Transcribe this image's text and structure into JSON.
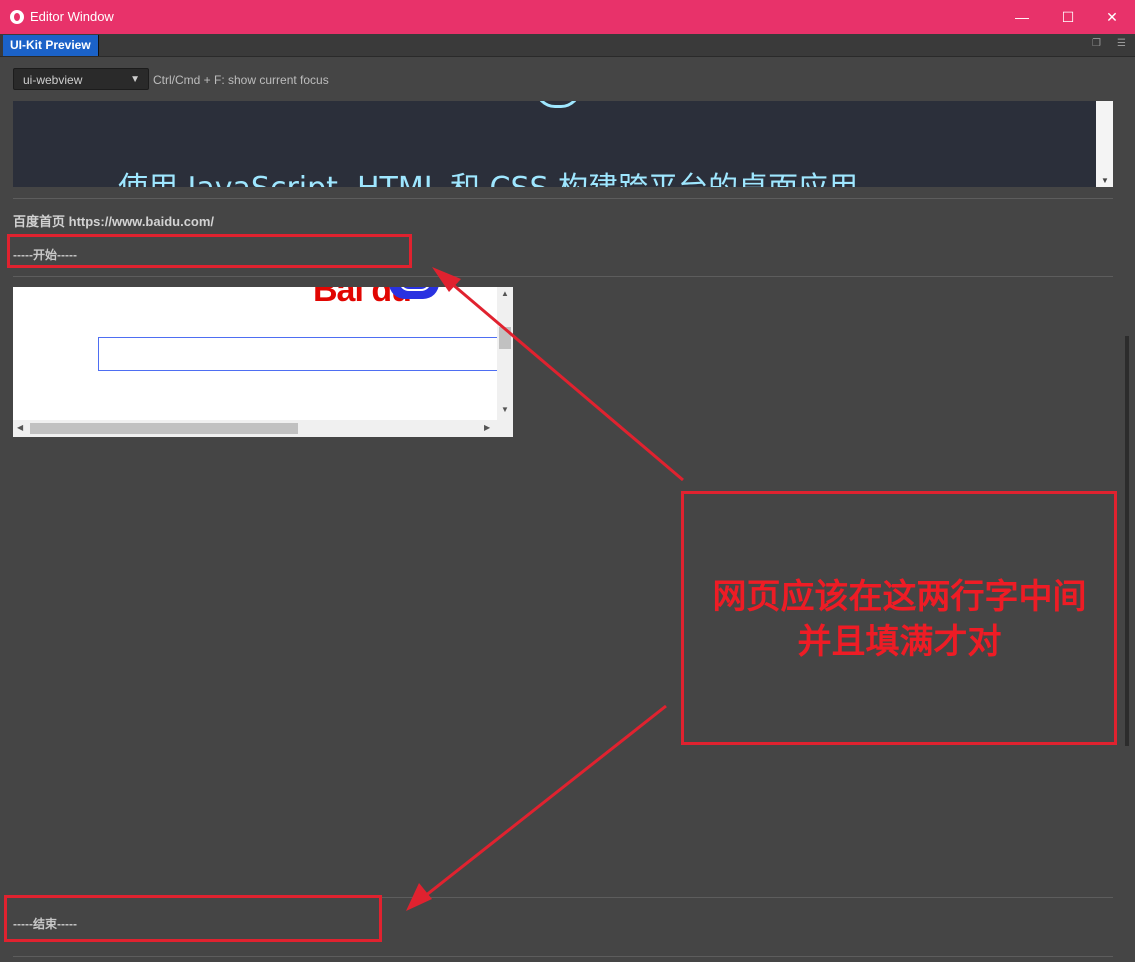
{
  "window": {
    "title": "Editor Window",
    "controls": {
      "minimize": "—",
      "maximize": "☐",
      "close": "✕"
    }
  },
  "tabs": [
    {
      "label": "UI-Kit Preview",
      "active": true
    }
  ],
  "toolbar": {
    "select_value": "ui-webview",
    "hint": "Ctrl/Cmd + F: show current focus"
  },
  "webview_top": {
    "text": "使用 JavaScript, HTML 和 CSS 构建跨平台的桌面应用"
  },
  "sections": {
    "baidu_label": "百度首页",
    "baidu_url": "https://www.baidu.com/",
    "start_marker": "-----开始-----",
    "end_marker": "-----结束-----"
  },
  "webview_baidu": {
    "logo_text": "Bai  du"
  },
  "annotation": {
    "line1": "网页应该在这两行字中间",
    "line2": "并且填满才对",
    "color": "#e0222f"
  },
  "colors": {
    "titlebar": "#e8326a",
    "tab_active": "#1b62c8",
    "panel_bg": "#454545"
  }
}
